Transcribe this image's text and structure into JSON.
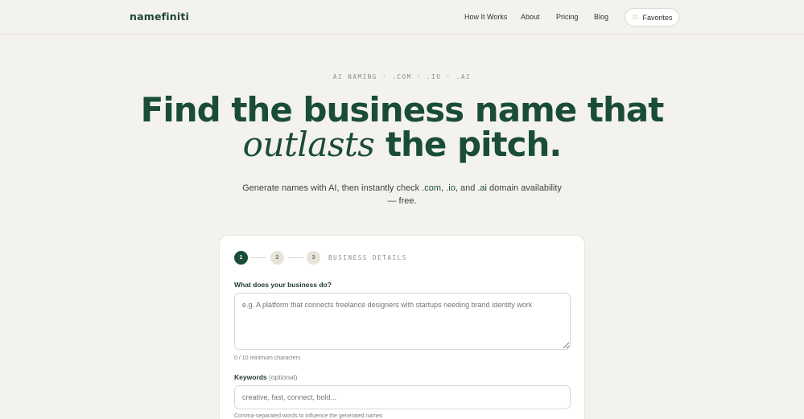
{
  "header": {
    "logo": "namefiniti",
    "nav": [
      "How It Works",
      "About",
      "Pricing",
      "Blog"
    ],
    "favorites_label": "Favorites",
    "favorites_icon": "star-icon"
  },
  "hero": {
    "eyebrow": "AI NAMING · .COM · .IO · .AI",
    "title_line1": "Find the business name that",
    "title_italic": "outlasts",
    "title_line2_rest": " the pitch.",
    "subtitle_before": "Generate names with AI, then instantly check ",
    "tld_com": ".com",
    "sep1": ", ",
    "tld_io": ".io",
    "sep2": ", and ",
    "tld_ai": ".ai",
    "subtitle_after": " domain availability — free."
  },
  "wizard": {
    "steps": [
      "1",
      "2",
      "3"
    ],
    "active_step": 1,
    "step_label": "BUSINESS DETAILS",
    "business_label": "What does your business do?",
    "business_placeholder": "e.g. A platform that connects freelance designers with startups needing brand identity work",
    "business_value": "",
    "char_counter": "0 / 10 minimum characters",
    "keywords_label": "Keywords",
    "keywords_optional": "(optional)",
    "keywords_placeholder": "creative, fast, connect, bold...",
    "keywords_value": "",
    "keywords_hint": "Comma-separated words to influence the generated names"
  },
  "colors": {
    "brand_green": "#1a4d36",
    "page_bg": "#f4f2ee",
    "accent_star": "#c9a24a"
  }
}
